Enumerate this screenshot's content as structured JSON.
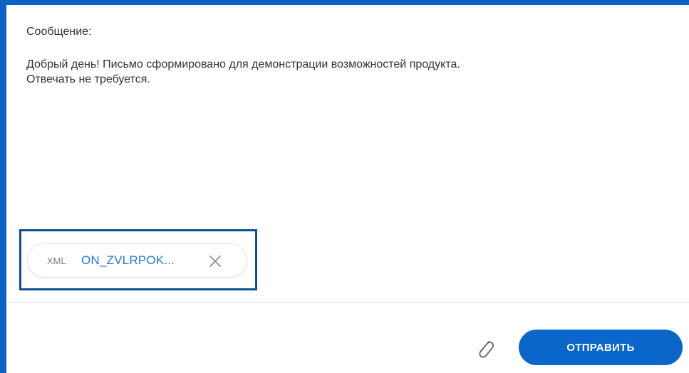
{
  "message": {
    "label": "Сообщение:",
    "body_line1": "Добрый день! Письмо сформировано для демонстрации возможностей продукта.",
    "body_line2": "Отвечать не требуется."
  },
  "attachment": {
    "type": "XML",
    "name": "ON_ZVLRPOK...",
    "remove_icon": "close-icon"
  },
  "footer": {
    "attach_icon": "paperclip-icon",
    "send_label": "ОТПРАВИТЬ"
  },
  "colors": {
    "accent": "#0a63c2",
    "send_button": "#0a66c8",
    "link": "#1f7ad4",
    "highlight_border": "#0f4f8f"
  }
}
